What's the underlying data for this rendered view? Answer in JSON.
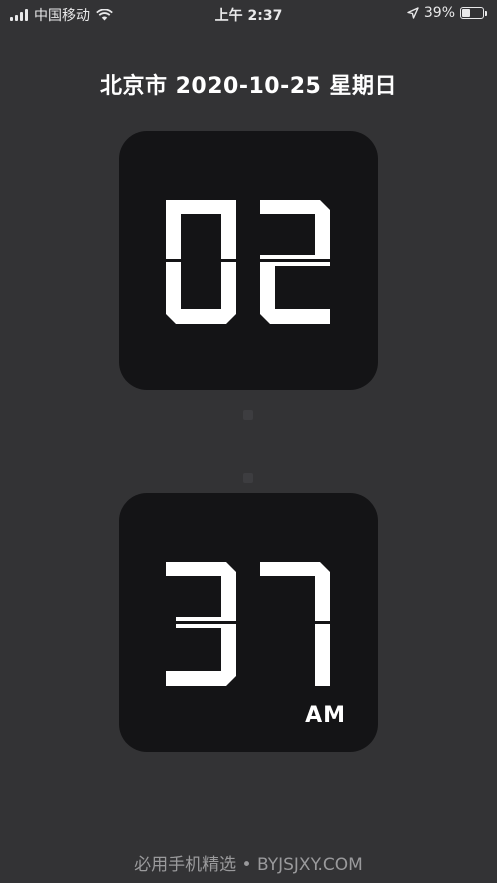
{
  "status_bar": {
    "carrier": "中国移动",
    "time": "上午 2:37",
    "battery_percent": "39%",
    "battery_level": 0.39,
    "icons": [
      "signal-icon",
      "wifi-icon",
      "location-icon",
      "battery-icon"
    ]
  },
  "date_line": "北京市 2020-10-25 星期日",
  "clock": {
    "hours": "02",
    "minutes": "37",
    "period": "AM"
  },
  "footer": "必用手机精选 • BYJSJXY.COM",
  "colors": {
    "background": "#333335",
    "card": "#141416",
    "digits": "#ffffff"
  }
}
